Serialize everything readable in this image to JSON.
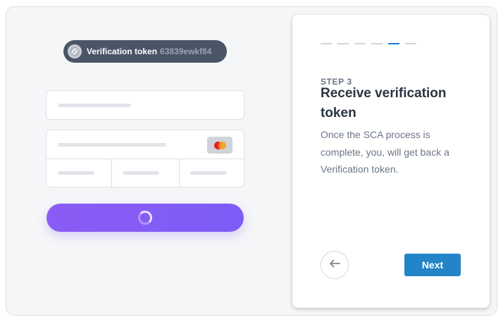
{
  "token": {
    "label": "Verification token",
    "value": "63839ewkf84",
    "icon": "token-stripes-icon"
  },
  "form": {
    "card_brand_icon": "mastercard-icon",
    "submit_state": "loading",
    "spinner_icon": "spinner-icon"
  },
  "steps": {
    "total": 6,
    "current": 5,
    "label": "STEP 3",
    "title": "Receive verification token",
    "description": "Once the SCA process is complete, you, will get back a Verification token.",
    "back_icon": "arrow-left-icon",
    "next_label": "Next"
  },
  "colors": {
    "accent": "#2384c8",
    "active_step": "#1c7ed6",
    "pay_button": "#8b5cf6",
    "token_pill": "#4a5567"
  }
}
